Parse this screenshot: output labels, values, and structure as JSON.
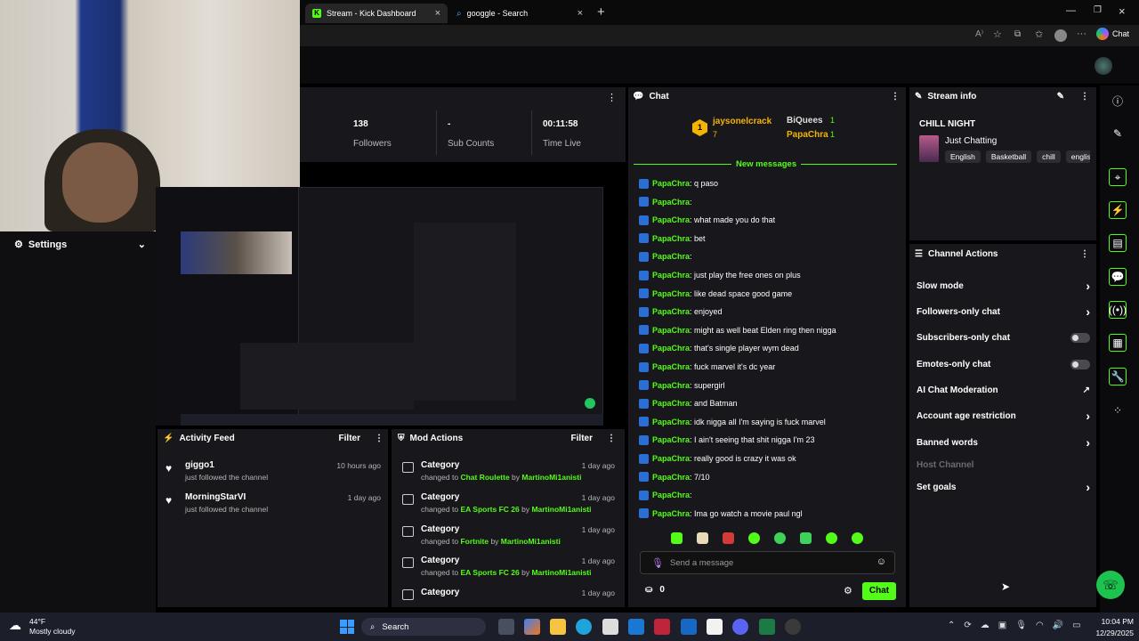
{
  "browser": {
    "tabs": [
      {
        "label": "Stream - Kick Dashboard"
      },
      {
        "label": "googgle - Search"
      }
    ],
    "chat_button": "Chat"
  },
  "stats": [
    {
      "value": "138",
      "label": "Followers"
    },
    {
      "value": "-",
      "label": "Sub Counts"
    },
    {
      "value": "00:11:58",
      "label": "Time Live"
    }
  ],
  "settings": {
    "label": "Settings"
  },
  "chat": {
    "title": "Chat",
    "leaders": [
      {
        "name": "jaysonelcrack",
        "count": "7"
      },
      {
        "name": "BiQuees",
        "count": "1"
      },
      {
        "name": "PapaChra",
        "count": "1"
      }
    ],
    "rank": "1",
    "new_messages": "New messages",
    "messages": [
      {
        "user": "PapaChra",
        "text": ": q paso"
      },
      {
        "user": "PapaChra",
        "text": ":"
      },
      {
        "user": "PapaChra",
        "text": ": what made you do that"
      },
      {
        "user": "PapaChra",
        "text": ": bet"
      },
      {
        "user": "PapaChra",
        "text": ":"
      },
      {
        "user": "PapaChra",
        "text": ": just play the free ones on plus"
      },
      {
        "user": "PapaChra",
        "text": ": like dead space good game"
      },
      {
        "user": "PapaChra",
        "text": ": enjoyed"
      },
      {
        "user": "PapaChra",
        "text": ": might as well beat Elden ring then nigga"
      },
      {
        "user": "PapaChra",
        "text": ": that's single player wym dead"
      },
      {
        "user": "PapaChra",
        "text": ": fuck marvel it's dc year"
      },
      {
        "user": "PapaChra",
        "text": ": supergirl"
      },
      {
        "user": "PapaChra",
        "text": ": and Batman"
      },
      {
        "user": "PapaChra",
        "text": ": idk nigga all I'm saying is fuck marvel"
      },
      {
        "user": "PapaChra",
        "text": ": I ain't seeing that shit nigga I'm 23"
      },
      {
        "user": "PapaChra",
        "text": ": really good is crazy it was ok"
      },
      {
        "user": "PapaChra",
        "text": ": 7/10"
      },
      {
        "user": "PapaChra",
        "text": ":"
      },
      {
        "user": "PapaChra",
        "text": ": Ima go watch a movie paul ngl"
      }
    ],
    "input_placeholder": "Send a message",
    "points": "0",
    "send_button": "Chat"
  },
  "stream_info": {
    "title": "Stream info",
    "stream_title": "CHILL NIGHT",
    "category": "Just Chatting",
    "tags": [
      "English",
      "Basketball",
      "chill",
      "englis"
    ]
  },
  "channel_actions": {
    "title": "Channel Actions",
    "items": [
      {
        "label": "Slow mode",
        "control": "chevron"
      },
      {
        "label": "Followers-only chat",
        "control": "chevron"
      },
      {
        "label": "Subscribers-only chat",
        "control": "toggle"
      },
      {
        "label": "Emotes-only chat",
        "control": "toggle"
      },
      {
        "label": "AI Chat Moderation",
        "control": "external"
      },
      {
        "label": "Account age restriction",
        "control": "chevron"
      },
      {
        "label": "Banned words",
        "control": "chevron"
      },
      {
        "label": "Host Channel",
        "control": "none"
      },
      {
        "label": "Set goals",
        "control": "chevron"
      }
    ]
  },
  "activity": {
    "title": "Activity Feed",
    "filter": "Filter",
    "items": [
      {
        "user": "giggo1",
        "text": "just followed the channel",
        "time": "10 hours ago"
      },
      {
        "user": "MorningStarVI",
        "text": "just followed the channel",
        "time": "1 day ago"
      }
    ]
  },
  "mod_actions": {
    "title": "Mod Actions",
    "filter": "Filter",
    "items": [
      {
        "title": "Category",
        "pre": "changed to ",
        "target": "Chat Roulette",
        "by": " by ",
        "mod": "MartinoMi1anisti",
        "time": "1 day ago"
      },
      {
        "title": "Category",
        "pre": "changed to ",
        "target": "EA Sports FC 26",
        "by": " by ",
        "mod": "MartinoMi1anisti",
        "time": "1 day ago"
      },
      {
        "title": "Category",
        "pre": "changed to ",
        "target": "Fortnite",
        "by": " by ",
        "mod": "MartinoMi1anisti",
        "time": "1 day ago"
      },
      {
        "title": "Category",
        "pre": "changed to ",
        "target": "EA Sports FC 26",
        "by": " by ",
        "mod": "MartinoMi1anisti",
        "time": "1 day ago"
      },
      {
        "title": "Category",
        "pre": "",
        "target": "",
        "by": "",
        "mod": "",
        "time": "1 day ago"
      }
    ]
  },
  "taskbar": {
    "weather_temp": "44°F",
    "weather_desc": "Mostly cloudy",
    "search": "Search",
    "time": "10:04 PM",
    "date": "12/29/2025"
  },
  "colors": {
    "accent": "#53fc18",
    "panel": "#18181c",
    "background": "#000000"
  }
}
